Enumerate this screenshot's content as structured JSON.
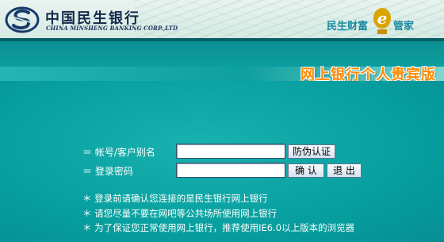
{
  "header": {
    "bank_name": "中国民生银行",
    "bank_name_en": "CHINA MINSHENG BANKING CORP.,LTD",
    "logo_icon": "minsheng-logo-icon",
    "slogan_left": "民生财富",
    "slogan_e": "e",
    "slogan_right": "管家"
  },
  "banner": {
    "title": "网上银行个人贵宾版"
  },
  "login_form": {
    "account_label": "＝ 帐号/客户别名",
    "password_label": "＝ 登录密码",
    "account_value": "",
    "password_value": "",
    "antiphish_button": "防伪认证",
    "confirm_button": "确 认",
    "exit_button": "退 出"
  },
  "notices": [
    "＊ 登录前请确认您连接的是民生银行网上银行",
    "＊ 请您尽量不要在网吧等公共场所使用网上银行",
    "＊ 为了保证您正常使用网上银行，推荐使用IE6.0以上版本的浏览器"
  ],
  "colors": {
    "page_background": "#079f9f",
    "banner_title": "#ff8a00",
    "brand_navy": "#13294a",
    "slogan_teal": "#1a8aa0"
  }
}
